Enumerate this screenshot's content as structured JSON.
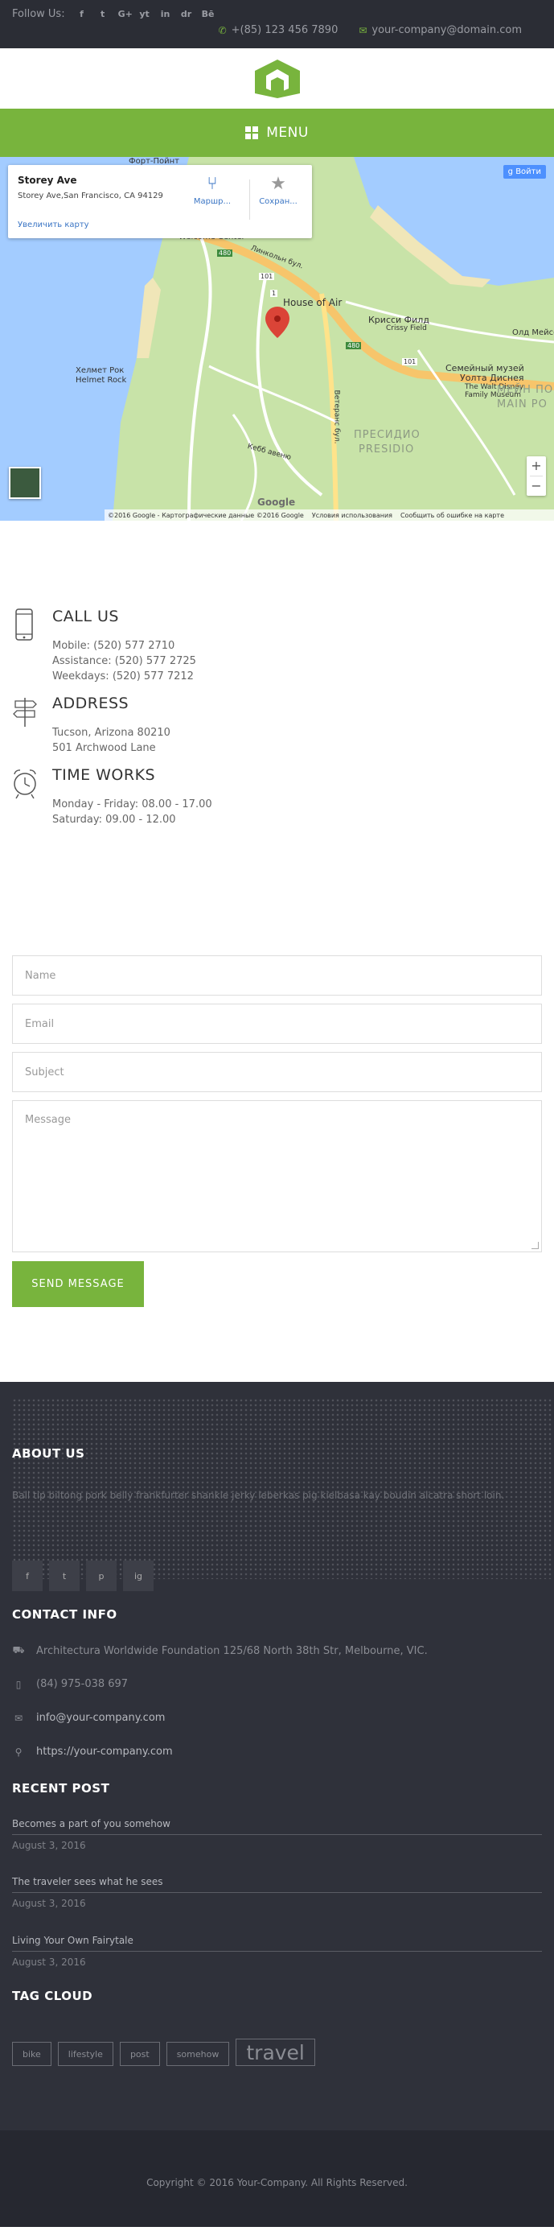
{
  "topbar": {
    "follow_label": "Follow Us:",
    "social": [
      "f",
      "t",
      "G+",
      "yt",
      "in",
      "dr",
      "Bē"
    ],
    "phone": "+(85) 123 456 7890",
    "email": "your-company@domain.com"
  },
  "menu": {
    "label": "MENU"
  },
  "map": {
    "card_title": "Storey Ave",
    "card_address": "Storey Ave,San Francisco, CA 94129",
    "card_link": "Увеличить карту",
    "route_label": "Маршр...",
    "save_label": "Сохран...",
    "login_label": "Войти",
    "google": "Google",
    "footer_copyright": "©2016 Google - Картографические данные ©2016 Google",
    "footer_terms": "Условия использования",
    "footer_report": "Сообщить об ошибке на карте",
    "labels": {
      "fort": "Форт-Пойнт",
      "welcome": "Welcome Center",
      "house": "House of Air",
      "crissy_ru": "Крисси Филд",
      "crissy_en": "Crissy Field",
      "old_mason": "Олд Мейсон",
      "disney_ru1": "Семейный музей",
      "disney_ru2": "Уолта Диснея",
      "disney_en1": "The Walt Disney",
      "disney_en2": "Family Museum",
      "helmet_ru": "Хелмет Рок",
      "helmet_en": "Helmet Rock",
      "presidio_ru": "ПРЕСИДИО",
      "presidio_en": "PRESIDIO",
      "main_post_ru": "МЕЙН ПО",
      "main_post_en": "MAIN PO",
      "lincoln": "Линкольн бул.",
      "veterans": "Ветеранс бул.",
      "kebb": "Кебб авеню",
      "r101a": "101",
      "r101b": "101",
      "r1": "1",
      "r480": "480",
      "r480b": "480"
    }
  },
  "contact": {
    "call": {
      "title": "CALL US",
      "lines": [
        "Mobile: (520) 577 2710",
        "Assistance: (520) 577 2725",
        "Weekdays: (520) 577 7212"
      ]
    },
    "address": {
      "title": "ADDRESS",
      "lines": [
        "Tucson, Arizona 80210",
        "501 Archwood Lane"
      ]
    },
    "hours": {
      "title": "TIME WORKS",
      "lines": [
        "Monday - Friday: 08.00 - 17.00",
        "Saturday: 09.00 - 12.00"
      ]
    }
  },
  "form": {
    "name_placeholder": "Name",
    "email_placeholder": "Email",
    "subject_placeholder": "Subject",
    "message_placeholder": "Message",
    "send_label": "SEND MESSAGE"
  },
  "footer": {
    "about_title": "ABOUT US",
    "about_text": "Ball tip biltong pork belly frankfurter shankle jerky leberkas pig kielbasa kay boudin alcatra short loin.",
    "social": [
      "f",
      "t",
      "p",
      "ig"
    ],
    "contact_title": "CONTACT INFO",
    "contact_address": "Architectura Worldwide Foundation 125/68 North 38th Str, Melbourne, VIC.",
    "contact_phone": "(84) 975-038 697",
    "contact_email": "info@your-company.com",
    "contact_web": "https://your-company.com",
    "recent_title": "RECENT POST",
    "posts": [
      {
        "title": "Becomes a part of you somehow",
        "date": "August 3, 2016"
      },
      {
        "title": "The traveler sees what he sees",
        "date": "August 3, 2016"
      },
      {
        "title": "Living Your Own Fairytale",
        "date": "August 3, 2016"
      }
    ],
    "tag_title": "TAG CLOUD",
    "tags": [
      "bike",
      "lifestyle",
      "post",
      "somehow",
      "travel"
    ],
    "copyright": "Copyright © 2016 Your-Company. All Rights Reserved."
  },
  "colors": {
    "accent": "#78b43d",
    "dark": "#2b2d35",
    "footer": "#2f313a"
  },
  "icons": {
    "phone": "phone-icon",
    "email": "envelope-icon",
    "menu": "grid-icon",
    "map_pin": "map-pin-icon"
  }
}
